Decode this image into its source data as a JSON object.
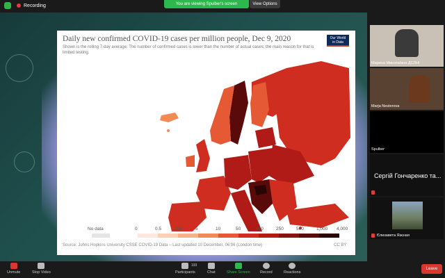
{
  "topbar": {
    "recording_label": "Recording",
    "banner_text": "You are viewing Spulber's screen",
    "view_options_label": "View Options"
  },
  "chart": {
    "title": "Daily new confirmed COVID-19 cases per million people, Dec 9, 2020",
    "subtitle": "Shown is the rolling 7-day average. The number of confirmed cases is lower than the number of actual cases; the main reason for that is limited testing.",
    "logo_line1": "Our World",
    "logo_line2": "in Data",
    "source": "Source: Johns Hopkins University CSSE COVID-19 Data – Last updated 10 December, 06:06 (London time)",
    "license": "CC BY"
  },
  "chart_data": {
    "type": "heatmap",
    "title": "Daily new confirmed COVID-19 cases per million people, Dec 9, 2020",
    "legend": {
      "nodata_label": "No data",
      "nodata_color": "#e5e5e5",
      "thresholds": [
        "0",
        "0.5",
        "2.5",
        "5",
        "10",
        "50",
        "100",
        "250",
        "500",
        "1,000",
        "4,000"
      ],
      "colors": [
        "#fde9dc",
        "#fcd0b4",
        "#f9b285",
        "#f38a54",
        "#e55a34",
        "#cf2d1f",
        "#b01b17",
        "#8a1212",
        "#5b0a0a",
        "#2a0505"
      ]
    },
    "regions": [
      {
        "name": "Iceland",
        "bin": 3
      },
      {
        "name": "Norway",
        "bin": 4
      },
      {
        "name": "Sweden",
        "bin": 7
      },
      {
        "name": "Finland",
        "bin": 4
      },
      {
        "name": "Russia",
        "bin": 5
      },
      {
        "name": "United Kingdom",
        "bin": 5
      },
      {
        "name": "Ireland",
        "bin": 4
      },
      {
        "name": "France",
        "bin": 5
      },
      {
        "name": "Spain",
        "bin": 5
      },
      {
        "name": "Germany",
        "bin": 6
      },
      {
        "name": "Poland",
        "bin": 6
      },
      {
        "name": "Italy",
        "bin": 6
      },
      {
        "name": "Balkans",
        "bin": 8
      },
      {
        "name": "Ukraine",
        "bin": 6
      },
      {
        "name": "Turkey",
        "bin": 6
      }
    ]
  },
  "participants": [
    {
      "name": "Марина Миколаївна ДСЛНІ",
      "kind": "video"
    },
    {
      "name": "Marja Nesterova",
      "kind": "video"
    },
    {
      "name": "Spulber",
      "kind": "blank"
    },
    {
      "name": "Сергій Гончаренко та...",
      "kind": "name-only"
    },
    {
      "name": "Єлизавета Язєная",
      "kind": "photo"
    }
  ],
  "toolbar": {
    "unmute": "Unmute",
    "stop_video": "Stop Video",
    "participants": "Participants",
    "participants_count": "193",
    "chat": "Chat",
    "share_screen": "Share Screen",
    "record": "Record",
    "reactions": "Reactions",
    "leave": "Leave"
  },
  "colors": {
    "accent_green": "#2db84d",
    "leave_red": "#d63a2e",
    "recording_red": "#e23b3b"
  }
}
